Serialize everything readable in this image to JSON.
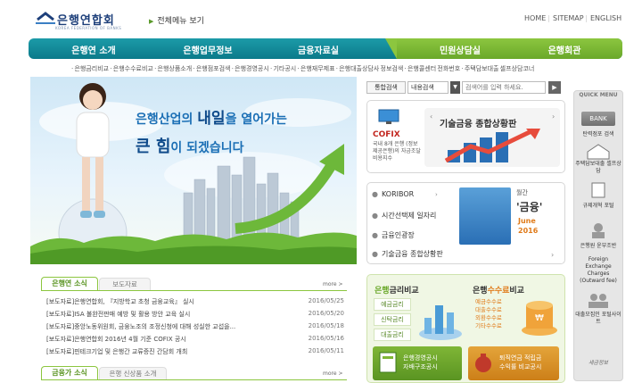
{
  "header": {
    "logo_text": "은행연합회",
    "logo_sub": "KOREA FEDERATION OF BANKS",
    "all_menu": "전체메뉴 보기",
    "util_links": [
      "HOME",
      "SITEMAP",
      "ENGLISH"
    ]
  },
  "nav": {
    "items": [
      "은행연 소개",
      "은행업무정보",
      "금융자료실",
      "민원상담실",
      "은행회관"
    ]
  },
  "subnav": "· 은행금리비교 · 은행수수료비교 · 은행상품소개 · 은행점포검색 · 은행경영공시 · 기타공시 · 은행재무제표 · 은행대출상담사 정보검색 · 은행콜센터 전화번호 · 주택담보대출 셀프상담코너",
  "hero": {
    "line1_prefix": "은행산업의 ",
    "line1_big": "내일",
    "line1_suffix": "을 열어가는",
    "line2_big": "큰 힘",
    "line2_suffix": "이 되겠습니다"
  },
  "search": {
    "label": "통합검색",
    "select_value": "내용검색",
    "placeholder": "검색어를 입력 하세요.",
    "button": "▶"
  },
  "quick_menu": {
    "title": "QUICK MENU",
    "bank_icon_label": "BANK",
    "items": [
      "탄력점포 검색",
      "주택담보대출 셀프상담",
      "규제개혁 포털",
      "은행원 윤부조반",
      "Foreign Exchange Charges (Outward fee)",
      "대출모집인 포털사이트",
      "세금정보"
    ]
  },
  "cofix": {
    "logo": "COFIX",
    "desc": "국내 8개 은행 (정보제공은행)의 자금조달비용지수",
    "card_title": "기술금융 종합상황판"
  },
  "links": {
    "items": [
      "KORIBOR",
      "시간선택제 일자리",
      "금융인광장",
      "기술금융 종합상황판"
    ],
    "mag_month": "월간",
    "mag_title": "'금융'",
    "mag_june": "June",
    "mag_year": "2016"
  },
  "rates": {
    "head1_bold": "은행",
    "head1_rest": "금리비교",
    "head2_bold": "은행",
    "head2_mid": "수수료",
    "head2_rest": "비교",
    "buttons": [
      "예금금리",
      "신탁금리",
      "대출금리"
    ],
    "fees": [
      "예금수수료",
      "대출수수료",
      "외환수수료",
      "기타수수료"
    ],
    "banner1": [
      "은행경영공시",
      "자배구조공시"
    ],
    "banner2": [
      "퇴직연금 적립금",
      "수익률 비교공시"
    ]
  },
  "news": {
    "tab1": "은행연 소식",
    "tab2": "보도자료",
    "more": "more >",
    "rows": [
      {
        "title": "[보도자료]은행연합회, 『지방학교 초청 금융교육』 실시",
        "date": "2016/05/25"
      },
      {
        "title": "[보도자료]ISA 불완전판매 예방 및 활용 방안 교육 실시",
        "date": "2016/05/20"
      },
      {
        "title": "[보도자료]중앙노동위원회, 금융노조의 조정신청에 대해 성실한 교섭을...",
        "date": "2016/05/18"
      },
      {
        "title": "[보도자료]은행연합회 2016년 4월 기준 COFIX 공시",
        "date": "2016/05/16"
      },
      {
        "title": "[보도자료]핀테크기업 및 은행간 교류증진 간담회 개최",
        "date": "2016/05/11"
      }
    ],
    "tab3": "금융가 소식",
    "tab4": "은행 신상품 소개"
  },
  "colors": {
    "nav_teal": "#0b7a8a",
    "nav_green": "#8cc63f",
    "accent_orange": "#e07b1a",
    "brand_blue": "#1d3f7a"
  }
}
